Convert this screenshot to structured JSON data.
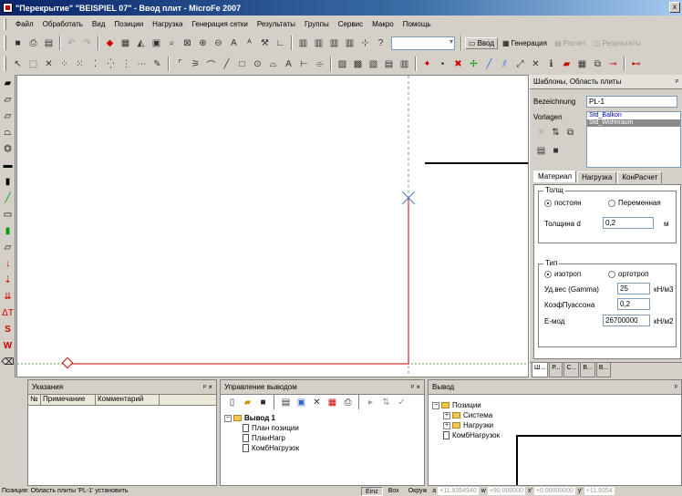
{
  "window": {
    "title": "\"Перекрытие\" \"BEISPIEL 07\" - Ввод плит - MicroFe 2007",
    "close_label": "x"
  },
  "menu": [
    "Файл",
    "Обработать",
    "Вид",
    "Позиции",
    "Нагрузка",
    "Генерация сетки",
    "Результаты",
    "Группы",
    "Сервис",
    "Макро",
    "Помощь"
  ],
  "modes": {
    "input": "Ввод",
    "generation": "Генерация",
    "calc": "Расчет",
    "results": "Результаты"
  },
  "side_panel": {
    "title": "Шаблоны, Область плиты",
    "pin": "ᵖ",
    "bezeichnung_label": "Bezeichnung",
    "bezeichnung_value": "PL-1",
    "vorlagen_label": "Vorlagen",
    "vorlagen_items": [
      "Std_Balkon",
      "Std_Wohnraum"
    ],
    "tabs": [
      "Материал",
      "Нагрузка",
      "КонРасчет"
    ],
    "thickness_group": "Толщ",
    "radio_const": "постоян",
    "radio_var": "Переменная",
    "thickness_label": "Толщина d",
    "thickness_value": "0,2",
    "thickness_unit": "м",
    "type_group": "Тип",
    "radio_iso": "изотроп",
    "radio_ortho": "ортотроп",
    "gamma_label": "Уд.вес (Gamma)",
    "gamma_value": "25",
    "gamma_unit": "кН/м3",
    "poisson_label": "КоэфПуассона",
    "poisson_value": "0,2",
    "emod_label": "E-мод",
    "emod_value": "26700000",
    "emod_unit": "кН/м2",
    "bottom_tabs": [
      "Ш...",
      "Р...",
      "С...",
      "В...",
      "В..."
    ]
  },
  "panels": {
    "hints": {
      "title": "Указания",
      "pin": "ᵖ ×",
      "col_no": "№",
      "col_note": "Примечание",
      "col_comment": "Комментарий"
    },
    "output_mgmt": {
      "title": "Управление выводом",
      "pin": "ᵖ ×",
      "root": "Вывод 1",
      "items": [
        "План позиции",
        "ПланНагр",
        "КомбНагрузок"
      ]
    },
    "output": {
      "title": "Вывод",
      "pin": "ᵖ",
      "root": "Позиции",
      "children": [
        "Система",
        "Нагрузки"
      ],
      "extra": "КомбНагрузок"
    }
  },
  "status": {
    "message": "Позиция: Область плиты 'PL-1' установить",
    "einz": "Einz",
    "box": "Box",
    "okruzh": "Окруж",
    "a_label": "a",
    "a_value": "+11.9354940",
    "w_label": "w",
    "w_value": "+90.000000",
    "x_label": "x'",
    "x_value": "+0.00000000",
    "y_label": "y'",
    "y_value": "+11.9354"
  },
  "colors": {
    "accent_red": "#cc0000",
    "titlebar": "#0a246a",
    "guide_blue": "#4a78c8"
  }
}
